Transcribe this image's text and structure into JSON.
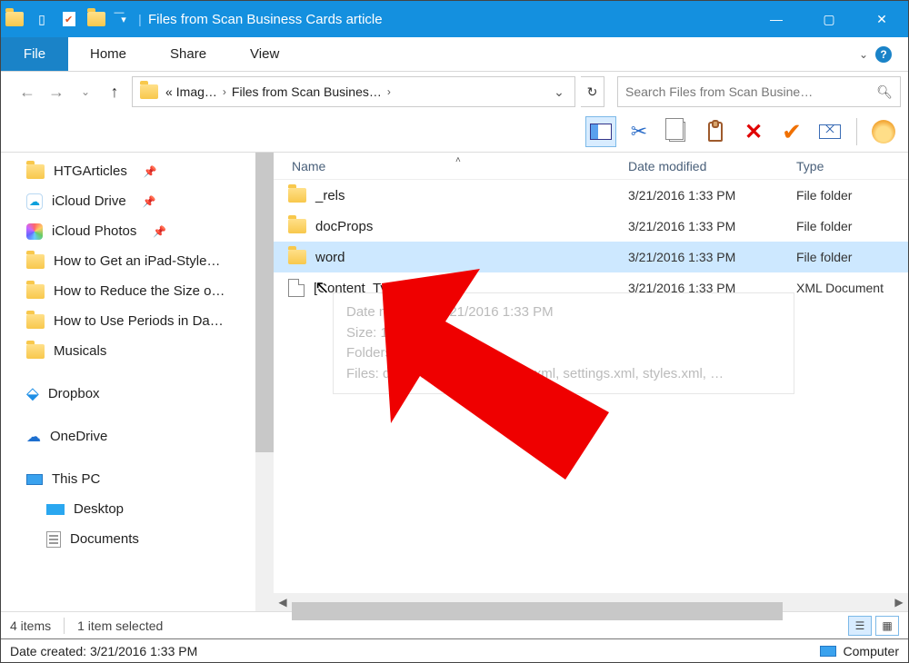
{
  "titlebar": {
    "title": "Files from Scan Business Cards article"
  },
  "ribbon": {
    "file": "File",
    "tabs": [
      "Home",
      "Share",
      "View"
    ]
  },
  "nav": {
    "crumb_label_1": "Imag…",
    "crumb_label_2": "Files from Scan Busines…",
    "search_placeholder": "Search Files from Scan Busine…"
  },
  "columns": {
    "name": "Name",
    "date": "Date modified",
    "type": "Type"
  },
  "files": [
    {
      "name": "_rels",
      "date": "3/21/2016 1:33 PM",
      "type": "File folder",
      "kind": "folder",
      "selected": false
    },
    {
      "name": "docProps",
      "date": "3/21/2016 1:33 PM",
      "type": "File folder",
      "kind": "folder",
      "selected": false
    },
    {
      "name": "word",
      "date": "3/21/2016 1:33 PM",
      "type": "File folder",
      "kind": "folder",
      "selected": true
    },
    {
      "name": "[Content_Types].xml",
      "date": "3/21/2016 1:33 PM",
      "type": "XML Document",
      "kind": "file",
      "selected": false
    }
  ],
  "tooltip": {
    "line1": "Date modified: 3/21/2016 1:33 PM",
    "line2": "Size: 1.82 KB",
    "line3": "Folders: _rels, theme",
    "line4": "Files: document.xml, fontTable.xml, settings.xml, styles.xml, …"
  },
  "sidebar": {
    "items": [
      {
        "label": "HTGArticles",
        "icon": "folder",
        "pinned": true
      },
      {
        "label": "iCloud Drive",
        "icon": "icloud",
        "pinned": true
      },
      {
        "label": "iCloud Photos",
        "icon": "photos",
        "pinned": true
      },
      {
        "label": "How to Get an iPad-Style…",
        "icon": "folder"
      },
      {
        "label": "How to Reduce the Size o…",
        "icon": "folder"
      },
      {
        "label": "How to Use Periods in Da…",
        "icon": "folder"
      },
      {
        "label": "Musicals",
        "icon": "folder"
      },
      {
        "label": "Dropbox",
        "icon": "dropbox",
        "gap": true
      },
      {
        "label": "OneDrive",
        "icon": "onedrive",
        "gap": true
      },
      {
        "label": "This PC",
        "icon": "pc",
        "gap": true
      },
      {
        "label": "Desktop",
        "icon": "desktop",
        "indent": true
      },
      {
        "label": "Documents",
        "icon": "docs",
        "indent": true
      }
    ]
  },
  "status": {
    "items_count": "4 items",
    "selected_count": "1 item selected"
  },
  "footer": {
    "date_created": "Date created: 3/21/2016 1:33 PM",
    "computer": "Computer"
  }
}
